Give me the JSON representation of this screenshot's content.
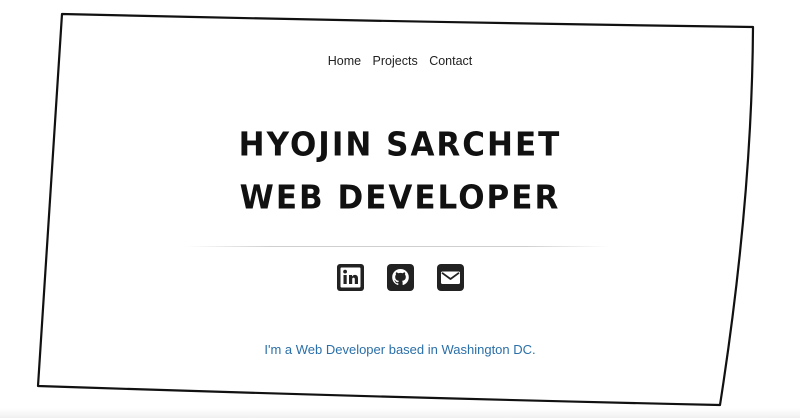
{
  "nav": {
    "items": [
      {
        "label": "Home"
      },
      {
        "label": "Projects"
      },
      {
        "label": "Contact"
      }
    ]
  },
  "hero": {
    "name": "HYOJIN SARCHET",
    "role": "WEB DEVELOPER"
  },
  "social": {
    "icons": [
      "linkedin-icon",
      "github-icon",
      "email-icon"
    ]
  },
  "tagline": "I'm a Web Developer based in Washington DC.",
  "colors": {
    "text": "#111111",
    "tagline": "#2a6fa8",
    "icon": "#222222",
    "frame": "#111111"
  }
}
